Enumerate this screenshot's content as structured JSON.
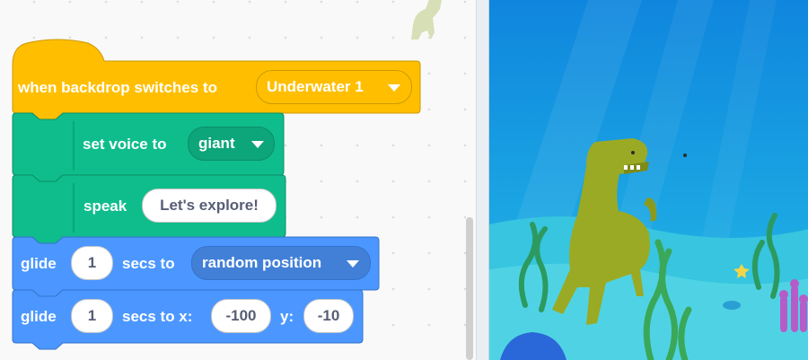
{
  "hat_block": {
    "label": "when backdrop switches to",
    "dropdown_value": "Underwater 1",
    "color": "#ffbf00"
  },
  "voice_block": {
    "label": "set voice to",
    "dropdown_value": "giant",
    "color": "#0fbd8c"
  },
  "speak_block": {
    "label": "speak",
    "input_value": "Let's explore!",
    "color": "#0fbd8c"
  },
  "glide_random_block": {
    "label_glide": "glide",
    "secs_value": "1",
    "label_secs": "secs to",
    "dropdown_value": "random position",
    "color": "#4c97ff"
  },
  "glide_xy_block": {
    "label_glide": "glide",
    "secs_value": "1",
    "label_secs_x": "secs to x:",
    "x_value": "-100",
    "label_y": "y:",
    "y_value": "-10",
    "color": "#4c97ff"
  },
  "stage": {
    "sprite": "dinosaur-icon",
    "backdrop": "underwater-backdrop"
  }
}
